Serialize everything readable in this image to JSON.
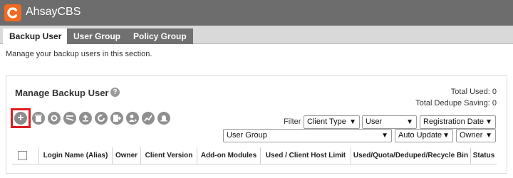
{
  "app": {
    "title": "AhsayCBS",
    "logo_icon": "ahsay-logo-icon",
    "brand_color": "#f26a21"
  },
  "tabs": [
    {
      "label": "Backup User",
      "active": true
    },
    {
      "label": "User Group",
      "active": false
    },
    {
      "label": "Policy Group",
      "active": false
    }
  ],
  "intro": "Manage your backup users in this section.",
  "panel": {
    "title": "Manage Backup User",
    "total_used": "Total Used: 0",
    "total_dedupe": "Total Dedupe Saving: 0"
  },
  "toolbar": {
    "icons": [
      "add-icon",
      "delete-icon",
      "settings-icon",
      "tools-icon",
      "upload-icon",
      "refresh-icon",
      "export-icon",
      "user-move-icon",
      "chart-icon",
      "notification-icon"
    ]
  },
  "filter": {
    "label": "Filter",
    "client_type": "Client Type",
    "user": "User",
    "registration_date": "Registration Date",
    "user_group": "User Group",
    "auto_update": "Auto Update",
    "owner": "Owner"
  },
  "table": {
    "columns": [
      "Login Name (Alias)",
      "Owner",
      "Client Version",
      "Add-on Modules",
      "Used / Client Host Limit",
      "Used/Quota/Deduped/Recycle Bin",
      "Status"
    ]
  }
}
